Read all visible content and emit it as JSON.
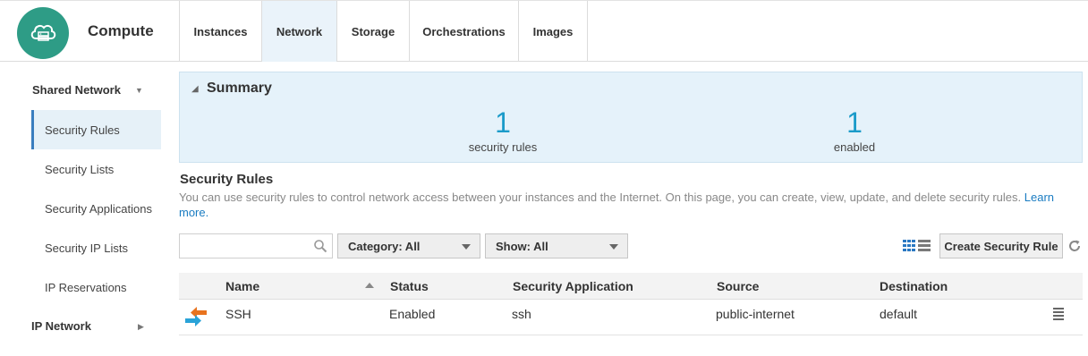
{
  "app": {
    "title": "Compute",
    "logo_icon": "cloud-server-icon"
  },
  "tabs": [
    {
      "label": "Instances",
      "active": false
    },
    {
      "label": "Network",
      "active": true
    },
    {
      "label": "Storage",
      "active": false
    },
    {
      "label": "Orchestrations",
      "active": false
    },
    {
      "label": "Images",
      "active": false
    }
  ],
  "sidebar": {
    "group_shared": "Shared Network",
    "items": [
      {
        "label": "Security Rules",
        "active": true
      },
      {
        "label": "Security Lists",
        "active": false
      },
      {
        "label": "Security Applications",
        "active": false
      },
      {
        "label": "Security IP Lists",
        "active": false
      },
      {
        "label": "IP Reservations",
        "active": false
      }
    ],
    "group_ip": "IP Network"
  },
  "summary": {
    "title": "Summary",
    "metrics": [
      {
        "value": "1",
        "label": "security rules"
      },
      {
        "value": "1",
        "label": "enabled"
      }
    ]
  },
  "section": {
    "title": "Security Rules",
    "description": "You can use security rules to control network access between your instances and the Internet. On this page, you can create, view, update, and delete security rules.",
    "learn_more": "Learn more."
  },
  "toolbar": {
    "search_placeholder": "",
    "category_filter": "Category: All",
    "show_filter": "Show: All",
    "create_label": "Create Security Rule"
  },
  "table": {
    "columns": [
      "Name",
      "Status",
      "Security Application",
      "Source",
      "Destination"
    ],
    "rows": [
      {
        "name": "SSH",
        "status": "Enabled",
        "application": "ssh",
        "source": "public-internet",
        "destination": "default"
      }
    ]
  },
  "colors": {
    "accent": "#1b9bc9",
    "logo": "#2e9c86",
    "active_tab": "#eaf3fa",
    "summary_bg": "#e5f2fa"
  }
}
